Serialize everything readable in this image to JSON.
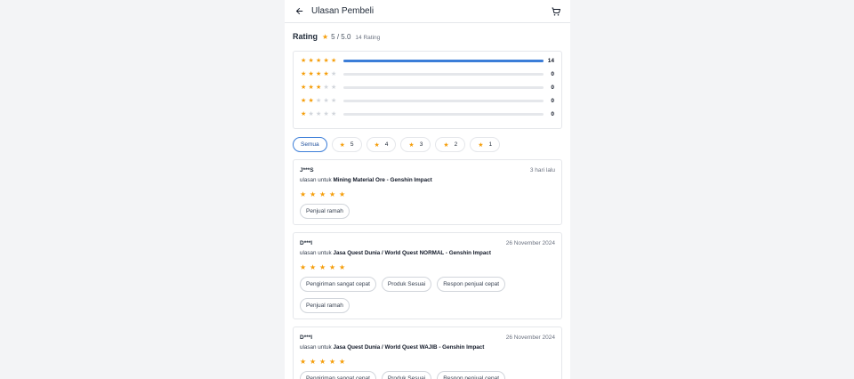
{
  "header": {
    "title": "Ulasan Pembeli",
    "back_icon": "arrow-left-icon",
    "cart_icon": "cart-icon"
  },
  "rating": {
    "label": "Rating",
    "score": "5 / 5.0",
    "count": "14 Rating"
  },
  "distribution": [
    {
      "stars": 5,
      "count": "14",
      "fraction": 1.0
    },
    {
      "stars": 4,
      "count": "0",
      "fraction": 0
    },
    {
      "stars": 3,
      "count": "0",
      "fraction": 0
    },
    {
      "stars": 2,
      "count": "0",
      "fraction": 0
    },
    {
      "stars": 1,
      "count": "0",
      "fraction": 0
    }
  ],
  "filters": [
    {
      "label": "Semua",
      "active": true
    },
    {
      "label": "5"
    },
    {
      "label": "4"
    },
    {
      "label": "3"
    },
    {
      "label": "2"
    },
    {
      "label": "1"
    }
  ],
  "review_prefix": "ulasan untuk",
  "reviews": [
    {
      "name": "J***S",
      "date": "3 hari lalu",
      "product": "Mining Material Ore - Genshin Impact",
      "stars": 5,
      "tags": [
        "Penjual ramah"
      ]
    },
    {
      "name": "D***I",
      "date": "26 November 2024",
      "product": "Jasa Quest Dunia / World Quest NORMAL - Genshin Impact",
      "stars": 5,
      "tags": [
        "Pengiriman sangat cepat",
        "Produk Sesuai",
        "Respon penjual cepat",
        "Penjual ramah"
      ]
    },
    {
      "name": "D***I",
      "date": "26 November 2024",
      "product": "Jasa Quest Dunia / World Quest WAJIB - Genshin Impact",
      "stars": 5,
      "tags": [
        "Pengiriman sangat cepat",
        "Produk Sesuai",
        "Respon penjual cepat"
      ]
    }
  ],
  "colors": {
    "accent": "#3b7dd8",
    "star": "#f59e0b"
  }
}
